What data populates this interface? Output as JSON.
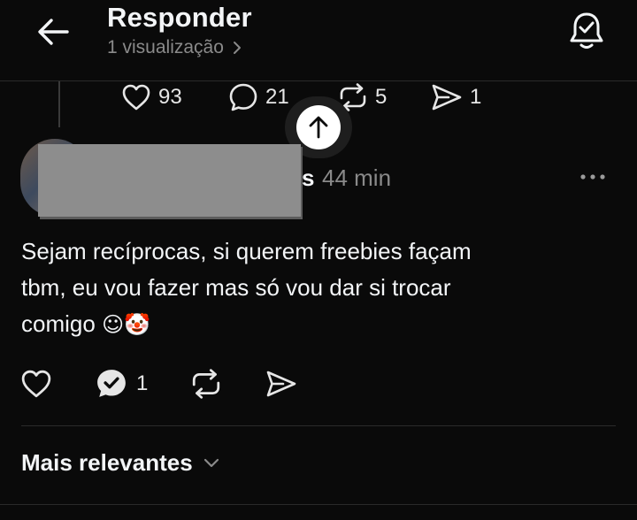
{
  "header": {
    "title": "Responder",
    "subtitle": "1 visualização",
    "icons": {
      "back": "arrow-left-icon",
      "subtitle_chevron": "chevron-right-icon",
      "notifications": "bell-check-icon"
    }
  },
  "previous_post": {
    "likes": "93",
    "replies": "21",
    "reposts": "5",
    "shares": "1"
  },
  "post": {
    "username_visible_fragment": "s",
    "time_ago": "44 min",
    "text_line1": "Sejam recíprocas, si querem freebies façam",
    "text_line2": "tbm, eu vou fazer mas só vou dar si trocar",
    "text_line3": "comigo",
    "emojis": "☺🤡",
    "reply_count": "1",
    "icons": {
      "more": "more-horizontal-icon",
      "like": "heart-icon",
      "reply": "reply-check-icon",
      "repost": "repost-icon",
      "share": "send-icon"
    }
  },
  "sort": {
    "label": "Mais relevantes",
    "icon": "chevron-down-icon"
  },
  "colors": {
    "background": "#0a0a0a",
    "text": "#f3f5f7",
    "secondary_text": "#8a8a8a",
    "redaction": "#8d8d8d"
  }
}
